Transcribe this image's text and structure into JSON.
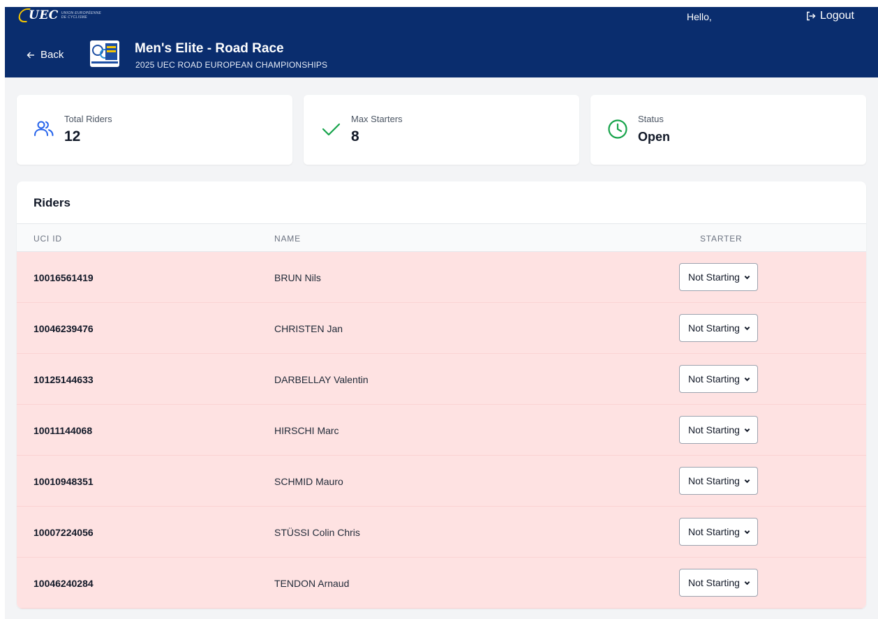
{
  "header": {
    "logo_text": "UEC",
    "logo_subtext_1": "UNION EUROPÉENNE",
    "logo_subtext_2": "DE CYCLISME",
    "greeting": "Hello,",
    "logout_label": "Logout",
    "back_label": "Back",
    "race_title": "Men's Elite - Road Race",
    "race_subtitle": "2025 UEC ROAD EUROPEAN CHAMPIONSHIPS"
  },
  "stats": {
    "total_riders": {
      "label": "Total Riders",
      "value": "12",
      "icon": "users-icon"
    },
    "max_starters": {
      "label": "Max Starters",
      "value": "8",
      "icon": "check-icon"
    },
    "status": {
      "label": "Status",
      "value": "Open",
      "icon": "clock-icon"
    }
  },
  "riders": {
    "title": "Riders",
    "columns": [
      "UCI ID",
      "NAME",
      "STARTER"
    ],
    "rows": [
      {
        "uci_id": "10016561419",
        "name": "BRUN Nils",
        "starter": "Not Starting"
      },
      {
        "uci_id": "10046239476",
        "name": "CHRISTEN Jan",
        "starter": "Not Starting"
      },
      {
        "uci_id": "10125144633",
        "name": "DARBELLAY Valentin",
        "starter": "Not Starting"
      },
      {
        "uci_id": "10011144068",
        "name": "HIRSCHI Marc",
        "starter": "Not Starting"
      },
      {
        "uci_id": "10010948351",
        "name": "SCHMID Mauro",
        "starter": "Not Starting"
      },
      {
        "uci_id": "10007224056",
        "name": "STÜSSI Colin Chris",
        "starter": "Not Starting"
      },
      {
        "uci_id": "10046240284",
        "name": "TENDON Arnaud",
        "starter": "Not Starting"
      }
    ]
  },
  "colors": {
    "header_bg": "#0a2d6e",
    "row_not_starting_bg": "#fee2e2",
    "users_icon": "#2563eb",
    "check_icon": "#16a34a",
    "clock_icon": "#16a34a"
  }
}
